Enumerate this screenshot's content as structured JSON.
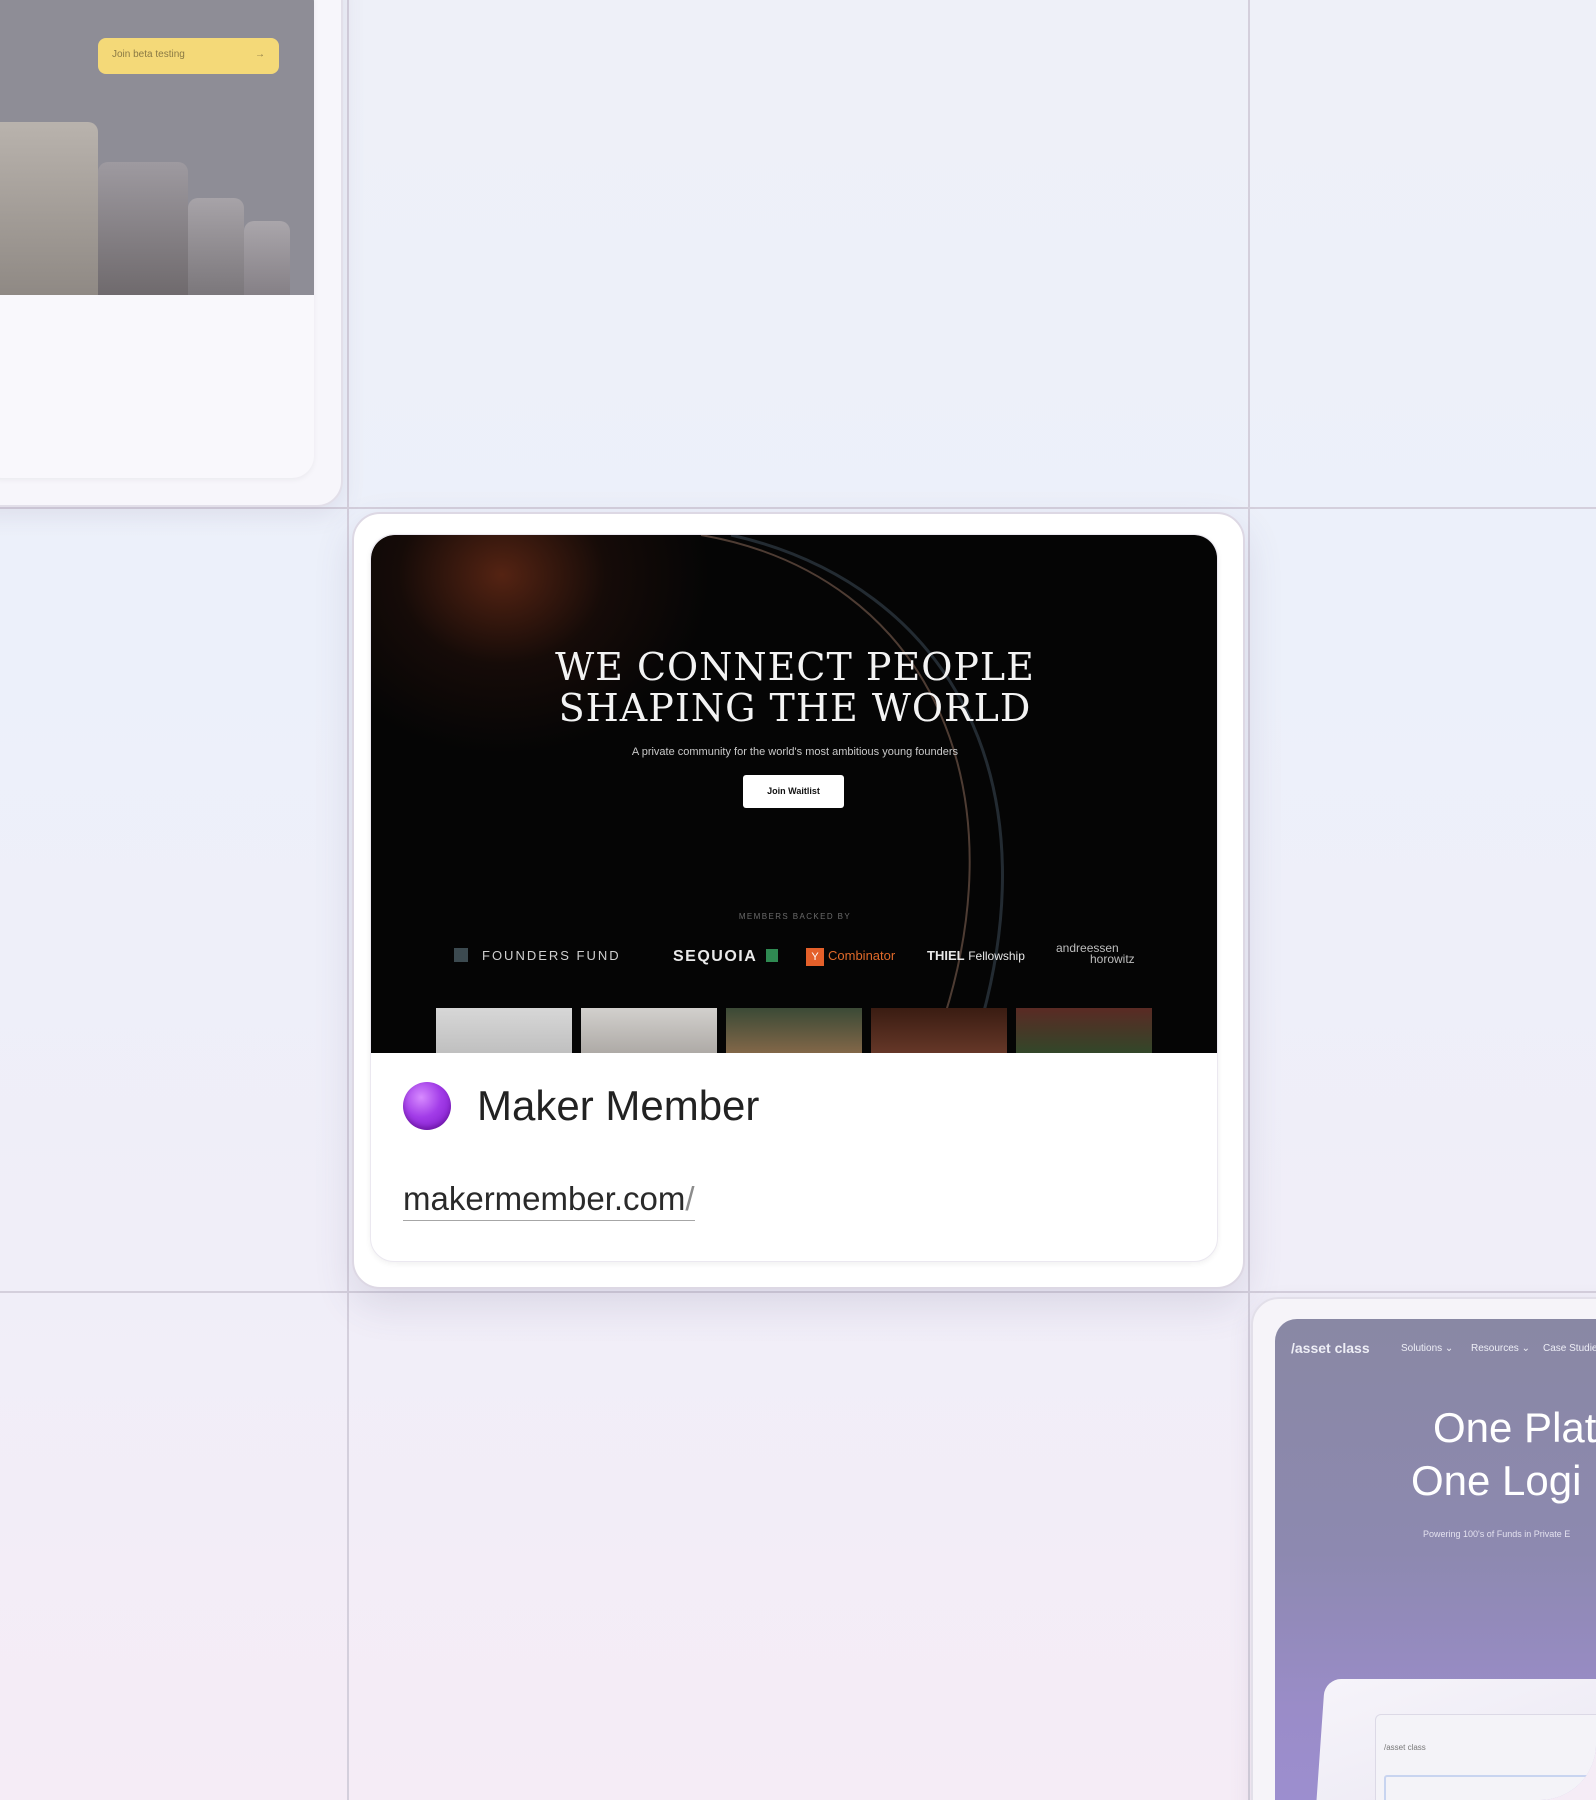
{
  "top_left_card": {
    "beta_button_label": "Join beta testing",
    "arrow_icon": "arrow-right-icon"
  },
  "main_card": {
    "preview": {
      "hero_line1": "WE CONNECT PEOPLE",
      "hero_line2": "SHAPING THE WORLD",
      "subtitle": "A private community for the world's most ambitious young founders",
      "cta_label": "Join Waitlist",
      "backed_label": "MEMBERS BACKED BY",
      "logos": {
        "founders_fund": "FOUNDERS FUND",
        "sequoia": "SEQUOIA",
        "yc_badge": "Y",
        "combinator": "Combinator",
        "thiel_bold": "THIEL",
        "thiel_rest": "Fellowship",
        "a16z_line1": "andreessen",
        "a16z_line2": "horowitz"
      }
    },
    "emoji_icon": "purple-circle-icon",
    "title": "Maker Member",
    "url_main": "makermember.com",
    "url_slash": "/"
  },
  "bottom_right_card": {
    "logo": "/asset class",
    "nav": [
      "Solutions",
      "Resources",
      "Case Studie"
    ],
    "hero_line1": "One Plat",
    "hero_line2": "One Logi",
    "subtitle": "Powering 100's of Funds in Private E",
    "screen_logo": "/asset class"
  },
  "colors": {
    "accent_purple": "#a23ce8",
    "beta_yellow": "#f4d978",
    "grid_line": "#d4cfdc"
  }
}
